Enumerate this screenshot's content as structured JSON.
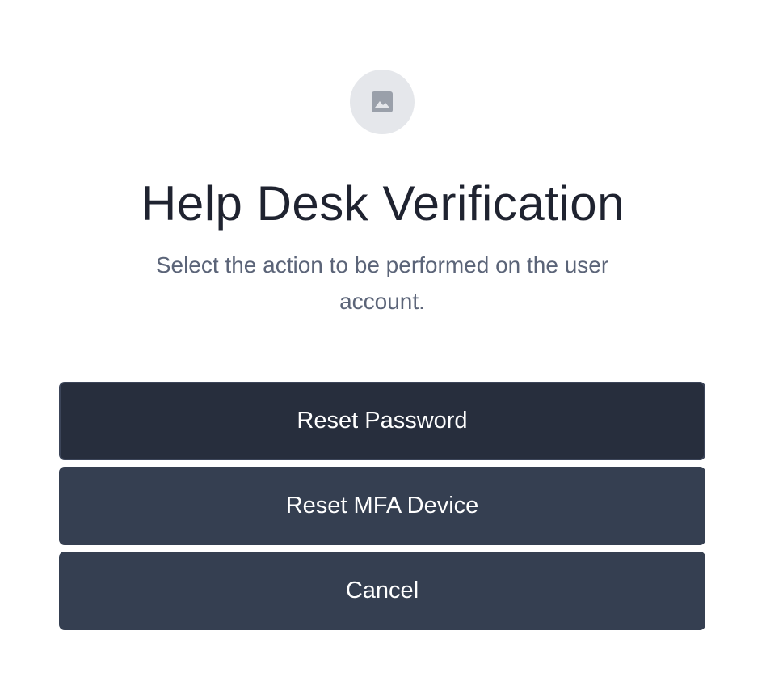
{
  "logo": {
    "icon": "image-placeholder-icon"
  },
  "title": "Help Desk Verification",
  "subtitle": "Select the action to be performed on the user account.",
  "actions": {
    "reset_password": "Reset Password",
    "reset_mfa": "Reset MFA Device",
    "cancel": "Cancel"
  },
  "colors": {
    "primary_button": "#272e3d",
    "secondary_button": "#353f51",
    "title_text": "#1f2330",
    "subtitle_text": "#5b6478",
    "logo_background": "#e5e7eb"
  }
}
